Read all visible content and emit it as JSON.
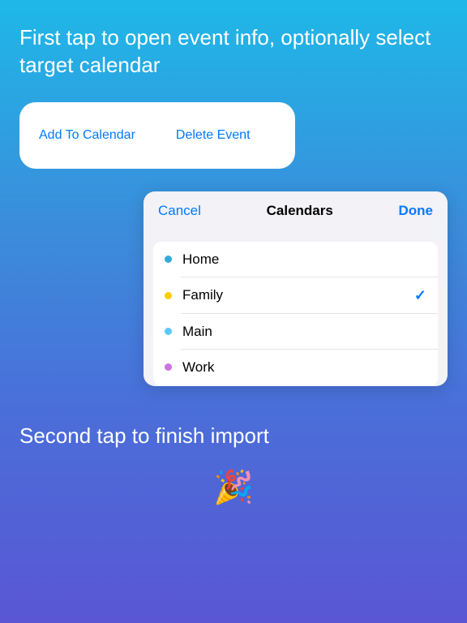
{
  "instruction1": "First tap to open event info, optionally select target calendar",
  "actionCard": {
    "addLabel": "Add To Calendar",
    "deleteLabel": "Delete Event"
  },
  "sheet": {
    "cancel": "Cancel",
    "title": "Calendars",
    "done": "Done",
    "items": [
      {
        "name": "Home",
        "color": "#34aadc",
        "selected": false
      },
      {
        "name": "Family",
        "color": "#ffcc00",
        "selected": true
      },
      {
        "name": "Main",
        "color": "#5ac8fa",
        "selected": false
      },
      {
        "name": "Work",
        "color": "#cc73e1",
        "selected": false
      }
    ]
  },
  "instruction2": "Second tap to finish import",
  "emoji": "🎉"
}
